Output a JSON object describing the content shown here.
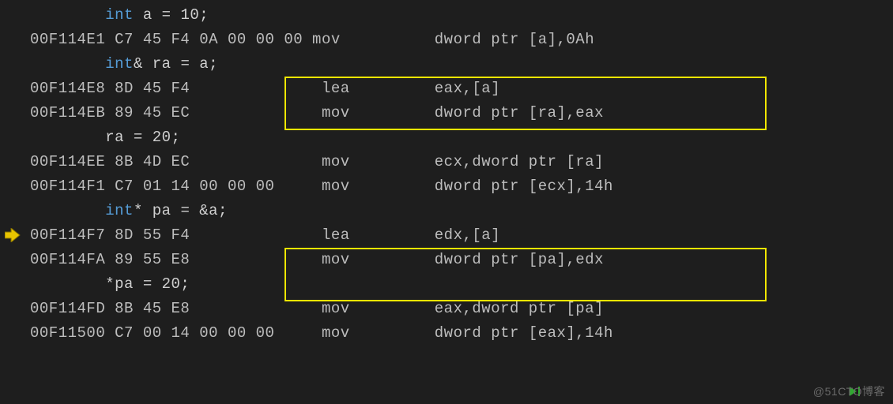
{
  "lines": [
    {
      "gut": "",
      "address": "",
      "hex": "",
      "segs": [
        {
          "pad": "        ",
          "t": "int",
          "cls": "kw"
        },
        {
          "t": " a = 10;",
          "cls": ""
        }
      ]
    },
    {
      "gut": "",
      "address": "00F114E1",
      "hex": " C7 45 F4 0A 00 00 00 ",
      "opcol": "mov",
      "args": "dword ptr [a],0Ah"
    },
    {
      "gut": "",
      "address": "",
      "hex": "",
      "segs": [
        {
          "pad": "        ",
          "t": "int",
          "cls": "kw"
        },
        {
          "t": "& ra = a;",
          "cls": ""
        }
      ]
    },
    {
      "gut": "",
      "address": "00F114E8",
      "hex": " 8D 45 F4             ",
      "opcol": " lea",
      "args": "eax,[a]"
    },
    {
      "gut": "",
      "address": "00F114EB",
      "hex": " 89 45 EC             ",
      "opcol": " mov",
      "args": "dword ptr [ra],eax"
    },
    {
      "gut": "",
      "address": "",
      "hex": "",
      "segs": [
        {
          "pad": "        ",
          "t": "ra = 20;",
          "cls": ""
        }
      ]
    },
    {
      "gut": "",
      "address": "00F114EE",
      "hex": " 8B 4D EC             ",
      "opcol": " mov",
      "args": "ecx,dword ptr [ra]"
    },
    {
      "gut": "",
      "address": "00F114F1",
      "hex": " C7 01 14 00 00 00    ",
      "opcol": " mov",
      "args": "dword ptr [ecx],14h"
    },
    {
      "gut": "",
      "address": "",
      "hex": "",
      "segs": [
        {
          "pad": "        ",
          "t": "int",
          "cls": "kw"
        },
        {
          "t": "* pa = &a;",
          "cls": ""
        }
      ]
    },
    {
      "gut": "arrow",
      "address": "00F114F7",
      "hex": " 8D 55 F4             ",
      "opcol": " lea",
      "args": "edx,[a]"
    },
    {
      "gut": "",
      "address": "00F114FA",
      "hex": " 89 55 E8             ",
      "opcol": " mov",
      "args": "dword ptr [pa],edx"
    },
    {
      "gut": "",
      "address": "",
      "hex": "",
      "segs": [
        {
          "pad": "        ",
          "t": "*pa = 20;",
          "cls": ""
        }
      ]
    },
    {
      "gut": "",
      "address": "00F114FD",
      "hex": " 8B 45 E8             ",
      "opcol": " mov",
      "args": "eax,dword ptr [pa]"
    },
    {
      "gut": "",
      "address": "00F11500",
      "hex": " C7 00 14 00 00 00    ",
      "opcol": " mov",
      "args": "dword ptr [eax],14h"
    }
  ],
  "watermark": "@51CTO博客"
}
